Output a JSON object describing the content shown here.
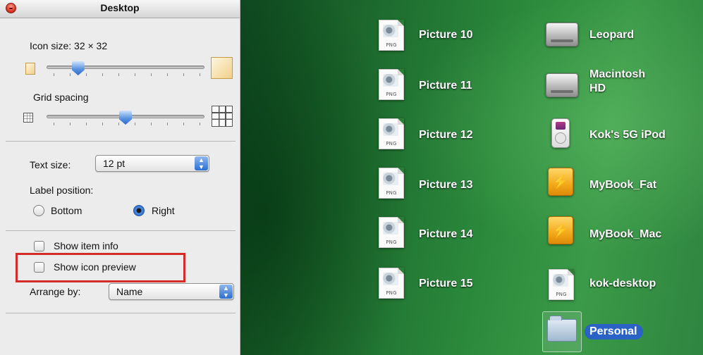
{
  "panel": {
    "title": "Desktop",
    "icon_size_label": "Icon size: 32 × 32",
    "icon_size_slider_value": 0.2,
    "grid_spacing_label": "Grid spacing",
    "grid_spacing_slider_value": 0.5,
    "text_size_label": "Text size:",
    "text_size_value": "12 pt",
    "label_position_label": "Label position:",
    "position_bottom": "Bottom",
    "position_right": "Right",
    "selected_position": "Right",
    "show_item_info": "Show item info",
    "show_icon_preview": "Show icon preview",
    "arrange_by_label": "Arrange by:",
    "arrange_by_value": "Name",
    "highlight_color": "#d42a2a"
  },
  "desktop": {
    "left_column": [
      {
        "label": "Picture 10",
        "icon": "png-file-icon",
        "file_type": "PNG"
      },
      {
        "label": "Picture 11",
        "icon": "png-file-icon",
        "file_type": "PNG"
      },
      {
        "label": "Picture 12",
        "icon": "png-file-icon",
        "file_type": "PNG"
      },
      {
        "label": "Picture 13",
        "icon": "png-file-icon",
        "file_type": "PNG"
      },
      {
        "label": "Picture 14",
        "icon": "png-file-icon",
        "file_type": "PNG"
      },
      {
        "label": "Picture 15",
        "icon": "png-file-icon",
        "file_type": "PNG"
      }
    ],
    "right_column": [
      {
        "label": "Leopard",
        "icon": "hard-drive-icon"
      },
      {
        "label_line1": "Macintosh",
        "label_line2": "HD",
        "icon": "hard-drive-icon"
      },
      {
        "label": "Kok's 5G iPod",
        "icon": "ipod-icon"
      },
      {
        "label": "MyBook_Fat",
        "icon": "external-drive-icon"
      },
      {
        "label": "MyBook_Mac",
        "icon": "external-drive-icon"
      },
      {
        "label": "kok-desktop",
        "icon": "png-file-icon",
        "file_type": "PNG"
      },
      {
        "label": "Personal",
        "icon": "folder-icon",
        "selected": true
      }
    ],
    "selection_color": "#2a62c6"
  }
}
